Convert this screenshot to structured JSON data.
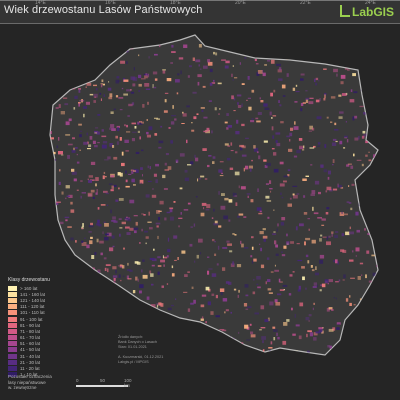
{
  "title": "Wiek drzewostanu Lasów Państwowych",
  "logo": "LabGIS",
  "legend": {
    "title": "Klasy drzewostanu",
    "items": [
      {
        "label": "> 160 lat",
        "color": "#fff2b2"
      },
      {
        "label": "141 - 160 lat",
        "color": "#fde2a0"
      },
      {
        "label": "121 - 140 lat",
        "color": "#fcc88c"
      },
      {
        "label": "111 - 120 lat",
        "color": "#fbae80"
      },
      {
        "label": "101 - 110 lat",
        "color": "#f7927a"
      },
      {
        "label": "91 - 100 lat",
        "color": "#ef7a7c"
      },
      {
        "label": "81 - 90 lat",
        "color": "#e2667f"
      },
      {
        "label": "71 - 80 lat",
        "color": "#d25a86"
      },
      {
        "label": "61 - 70 lat",
        "color": "#bd4f8c"
      },
      {
        "label": "51 - 60 lat",
        "color": "#a5468f"
      },
      {
        "label": "41 - 50 lat",
        "color": "#8b3d8f"
      },
      {
        "label": "31 - 40 lat",
        "color": "#70358a"
      },
      {
        "label": "21 - 30 lat",
        "color": "#582d82"
      },
      {
        "label": "11 - 20 lat",
        "color": "#432577"
      },
      {
        "label": "1 - 10 lat",
        "color": "#301c66"
      }
    ],
    "extra": [
      "Pozostałe oznaczenia",
      "lasy niepaństwowe",
      "w. zewnętrzne"
    ]
  },
  "credit": [
    "Źródło danych:",
    "Bank Danych o Lasach",
    "Stan: 01.01.2021",
    "",
    "A. Kuczmarski, 01.12.2021",
    "Labgis.pl / MPGIS"
  ],
  "scale": {
    "labels": [
      "0",
      "50",
      "100 km"
    ]
  },
  "coords_top": [
    "14°E",
    "16°E",
    "18°E",
    "20°E",
    "22°E",
    "24°E"
  ],
  "colors": {
    "boundary": "#b8b8b8",
    "background": "#202020",
    "land": "#3a3a3a"
  }
}
